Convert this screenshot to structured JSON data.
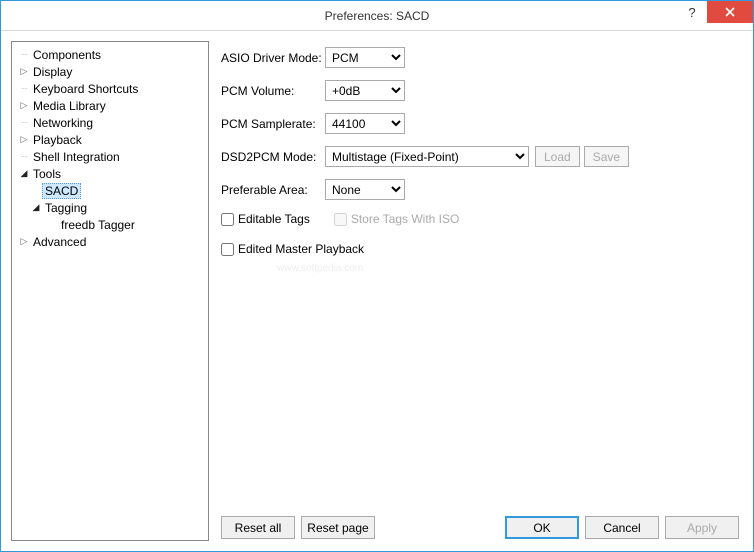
{
  "window": {
    "title": "Preferences: SACD"
  },
  "tree": {
    "components": "Components",
    "display": "Display",
    "keyboard": "Keyboard Shortcuts",
    "media": "Media Library",
    "networking": "Networking",
    "playback": "Playback",
    "shell": "Shell Integration",
    "tools": "Tools",
    "sacd": "SACD",
    "tagging": "Tagging",
    "freedb": "freedb Tagger",
    "advanced": "Advanced"
  },
  "form": {
    "asio_label": "ASIO Driver Mode:",
    "asio_value": "PCM",
    "pcmvol_label": "PCM Volume:",
    "pcmvol_value": "+0dB",
    "pcmrate_label": "PCM Samplerate:",
    "pcmrate_value": "44100",
    "dsd_label": "DSD2PCM Mode:",
    "dsd_value": "Multistage (Fixed-Point)",
    "load": "Load",
    "save": "Save",
    "area_label": "Preferable Area:",
    "area_value": "None",
    "editable_tags": "Editable Tags",
    "store_iso": "Store Tags With ISO",
    "edited_master": "Edited Master Playback"
  },
  "buttons": {
    "reset_all": "Reset all",
    "reset_page": "Reset page",
    "ok": "OK",
    "cancel": "Cancel",
    "apply": "Apply"
  },
  "watermark": "www.softpedia.com"
}
